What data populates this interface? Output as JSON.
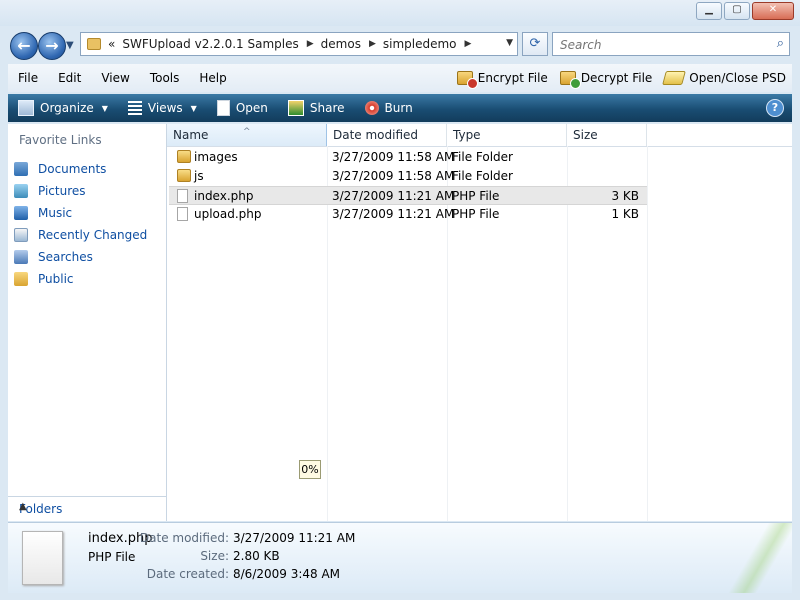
{
  "address": {
    "breadcrumb": [
      "«",
      "SWFUpload v2.2.0.1 Samples",
      "demos",
      "simpledemo"
    ],
    "search_placeholder": "Search"
  },
  "menu": {
    "items": [
      "File",
      "Edit",
      "View",
      "Tools",
      "Help"
    ],
    "right_tools": [
      "Encrypt File",
      "Decrypt File",
      "Open/Close PSD"
    ]
  },
  "toolbar": {
    "organize": "Organize",
    "views": "Views",
    "open": "Open",
    "share": "Share",
    "burn": "Burn",
    "help_icon": "?"
  },
  "nav": {
    "title": "Favorite Links",
    "links": [
      "Documents",
      "Pictures",
      "Music",
      "Recently Changed",
      "Searches",
      "Public"
    ],
    "folders_label": "Folders"
  },
  "columns": {
    "name": "Name",
    "date": "Date modified",
    "type": "Type",
    "size": "Size"
  },
  "files": [
    {
      "name": "images",
      "date": "3/27/2009 11:58 AM",
      "type": "File Folder",
      "size": "",
      "icon": "folder"
    },
    {
      "name": "js",
      "date": "3/27/2009 11:58 AM",
      "type": "File Folder",
      "size": "",
      "icon": "folder"
    },
    {
      "name": "index.php",
      "date": "3/27/2009 11:21 AM",
      "type": "PHP File",
      "size": "3 KB",
      "icon": "doc",
      "selected": true
    },
    {
      "name": "upload.php",
      "date": "3/27/2009 11:21 AM",
      "type": "PHP File",
      "size": "1 KB",
      "icon": "doc"
    }
  ],
  "progress": "0%",
  "details": {
    "name": "index.php",
    "type": "PHP File",
    "modified_label": "Date modified:",
    "modified": "3/27/2009 11:21 AM",
    "size_label": "Size:",
    "size": "2.80 KB",
    "created_label": "Date created:",
    "created": "8/6/2009 3:48 AM"
  }
}
